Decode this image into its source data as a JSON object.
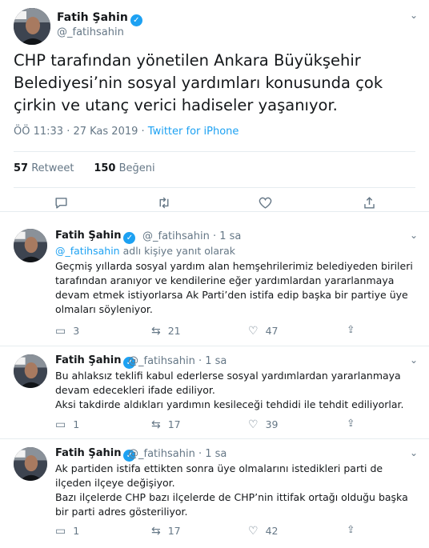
{
  "main": {
    "author": "Fatih Şahin",
    "handle": "@_fatihsahin",
    "text": "CHP tarafından yönetilen Ankara Büyükşehir Belediyesi’nin sosyal yardımları konusunda çok çirkin ve utanç verici hadiseler yaşanıyor.",
    "time": "ÖÖ 11:33 · 27 Kas 2019 ·",
    "source": "Twitter for iPhone",
    "retweets": "57",
    "retweets_label": "Retweet",
    "likes": "150",
    "likes_label": "Beğeni"
  },
  "replies": [
    {
      "author": "Fatih Şahin",
      "handle": "@_fatihsahin",
      "time": "· 1 sa",
      "reply_to_handle": "@_fatihsahin",
      "reply_to_suffix": "adlı kişiye yanıt olarak",
      "text": "Geçmiş yıllarda sosyal yardım alan hemşehrilerimiz belediyeden birileri tarafından aranıyor ve kendilerine eğer yardımlardan yararlanmaya devam etmek istiyorlarsa Ak Parti’den istifa edip başka bir partiye üye olmaları söyleniyor.",
      "replies": "3",
      "retweets": "21",
      "likes": "47"
    },
    {
      "author": "Fatih Şahin",
      "handle": "@_fatihsahin",
      "time": "· 1 sa",
      "text": "Bu ahlaksız teklifi kabul ederlerse sosyal yardımlardan yararlanmaya devam edecekleri ifade ediliyor.\nAksi takdirde aldıkları yardımın kesileceği tehdidi ile tehdit ediliyorlar.",
      "replies": "1",
      "retweets": "17",
      "likes": "39"
    },
    {
      "author": "Fatih Şahin",
      "handle": "@_fatihsahin",
      "time": "· 1 sa",
      "text": "Ak partiden istifa ettikten sonra üye olmalarını istedikleri parti de ilçeden ilçeye değişiyor.\nBazı ilçelerde CHP bazı ilçelerde de CHP’nin ittifak ortağı olduğu başka bir parti adres gösteriliyor.",
      "replies": "1",
      "retweets": "17",
      "likes": "42"
    }
  ],
  "icons": {
    "verified": "verified-badge-icon",
    "chevron": "chevron-down-icon",
    "reply": "reply-icon",
    "retweet": "retweet-icon",
    "like": "heart-icon",
    "share": "share-icon"
  },
  "colors": {
    "accent": "#1da1f2",
    "muted": "#657786",
    "text": "#14171a",
    "border": "#e6ecf0"
  }
}
